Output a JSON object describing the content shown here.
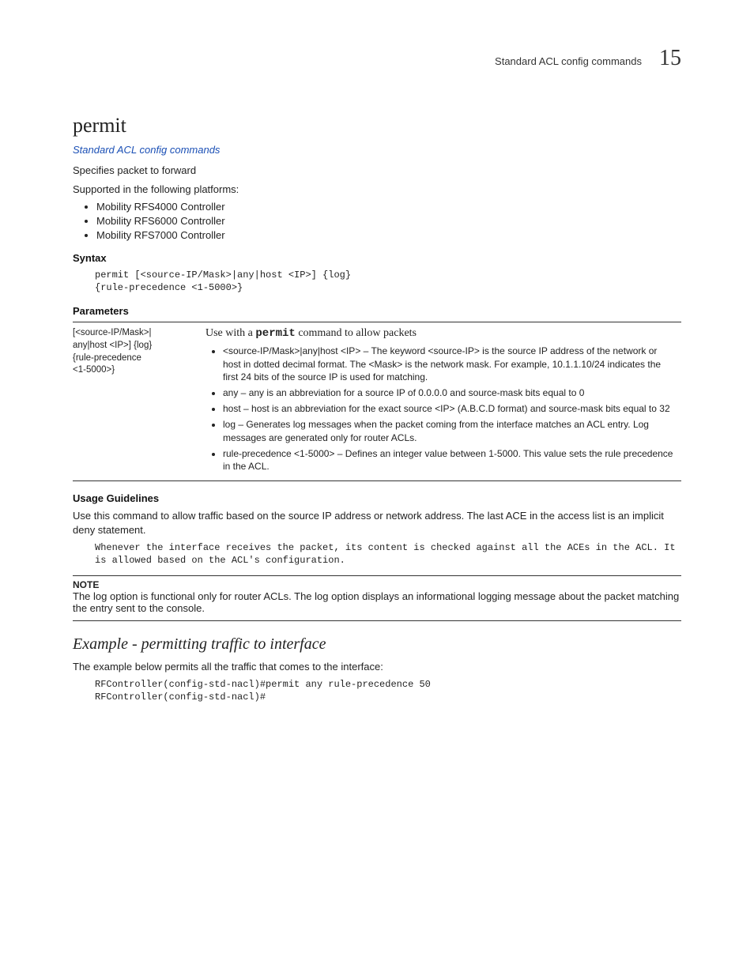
{
  "runhead": {
    "text": "Standard ACL config commands",
    "chapter": "15"
  },
  "title": "permit",
  "breadcrumb": "Standard ACL config commands",
  "intro1": "Specifies packet to forward",
  "intro2": "Supported in the following platforms:",
  "platforms": [
    "Mobility RFS4000 Controller",
    "Mobility RFS6000 Controller",
    "Mobility RFS7000 Controller"
  ],
  "syntax": {
    "heading": "Syntax",
    "code": "permit [<source-IP/Mask>|any|host <IP>] {log}\n{rule-precedence <1-5000>}"
  },
  "parameters": {
    "heading": "Parameters",
    "left": "[<source-IP/Mask>|\nany|host <IP>] {log}\n{rule-precedence\n<1-5000>}",
    "right_intro_pre": "Use with a ",
    "right_intro_cmd": "permit",
    "right_intro_post": " command to allow packets",
    "items": [
      "<source-IP/Mask>|any|host <IP> – The keyword <source-IP> is the source IP address of the network or host in dotted decimal format. The <Mask> is the network mask. For example, 10.1.1.10/24 indicates the first 24 bits of the source IP is used for matching.",
      "any – any is an abbreviation for a source IP of 0.0.0.0 and source-mask bits equal to 0",
      "host – host is an abbreviation for the exact source <IP> (A.B.C.D format) and source-mask bits equal to 32",
      "log – Generates log messages when the packet coming from the interface matches an ACL entry. Log messages are generated only for router ACLs.",
      "rule-precedence <1-5000> – Defines an integer value between 1-5000. This value sets the rule precedence in the ACL."
    ]
  },
  "usage": {
    "heading": "Usage Guidelines",
    "text": "Use this command to allow traffic based on the source IP address or network address. The last ACE in the access list is an implicit deny statement.",
    "code": "Whenever the interface receives the packet, its content is checked against all the ACEs in the ACL. It is allowed based on the ACL's configuration."
  },
  "note": {
    "label": "NOTE",
    "text": "The log option is functional only for router ACLs. The log option displays an informational logging message about the packet matching the entry sent to the console."
  },
  "example": {
    "heading": "Example - permitting traffic to interface",
    "text": "The example below permits all the traffic that comes to the interface:",
    "code": "RFController(config-std-nacl)#permit any rule-precedence 50\nRFController(config-std-nacl)#"
  }
}
